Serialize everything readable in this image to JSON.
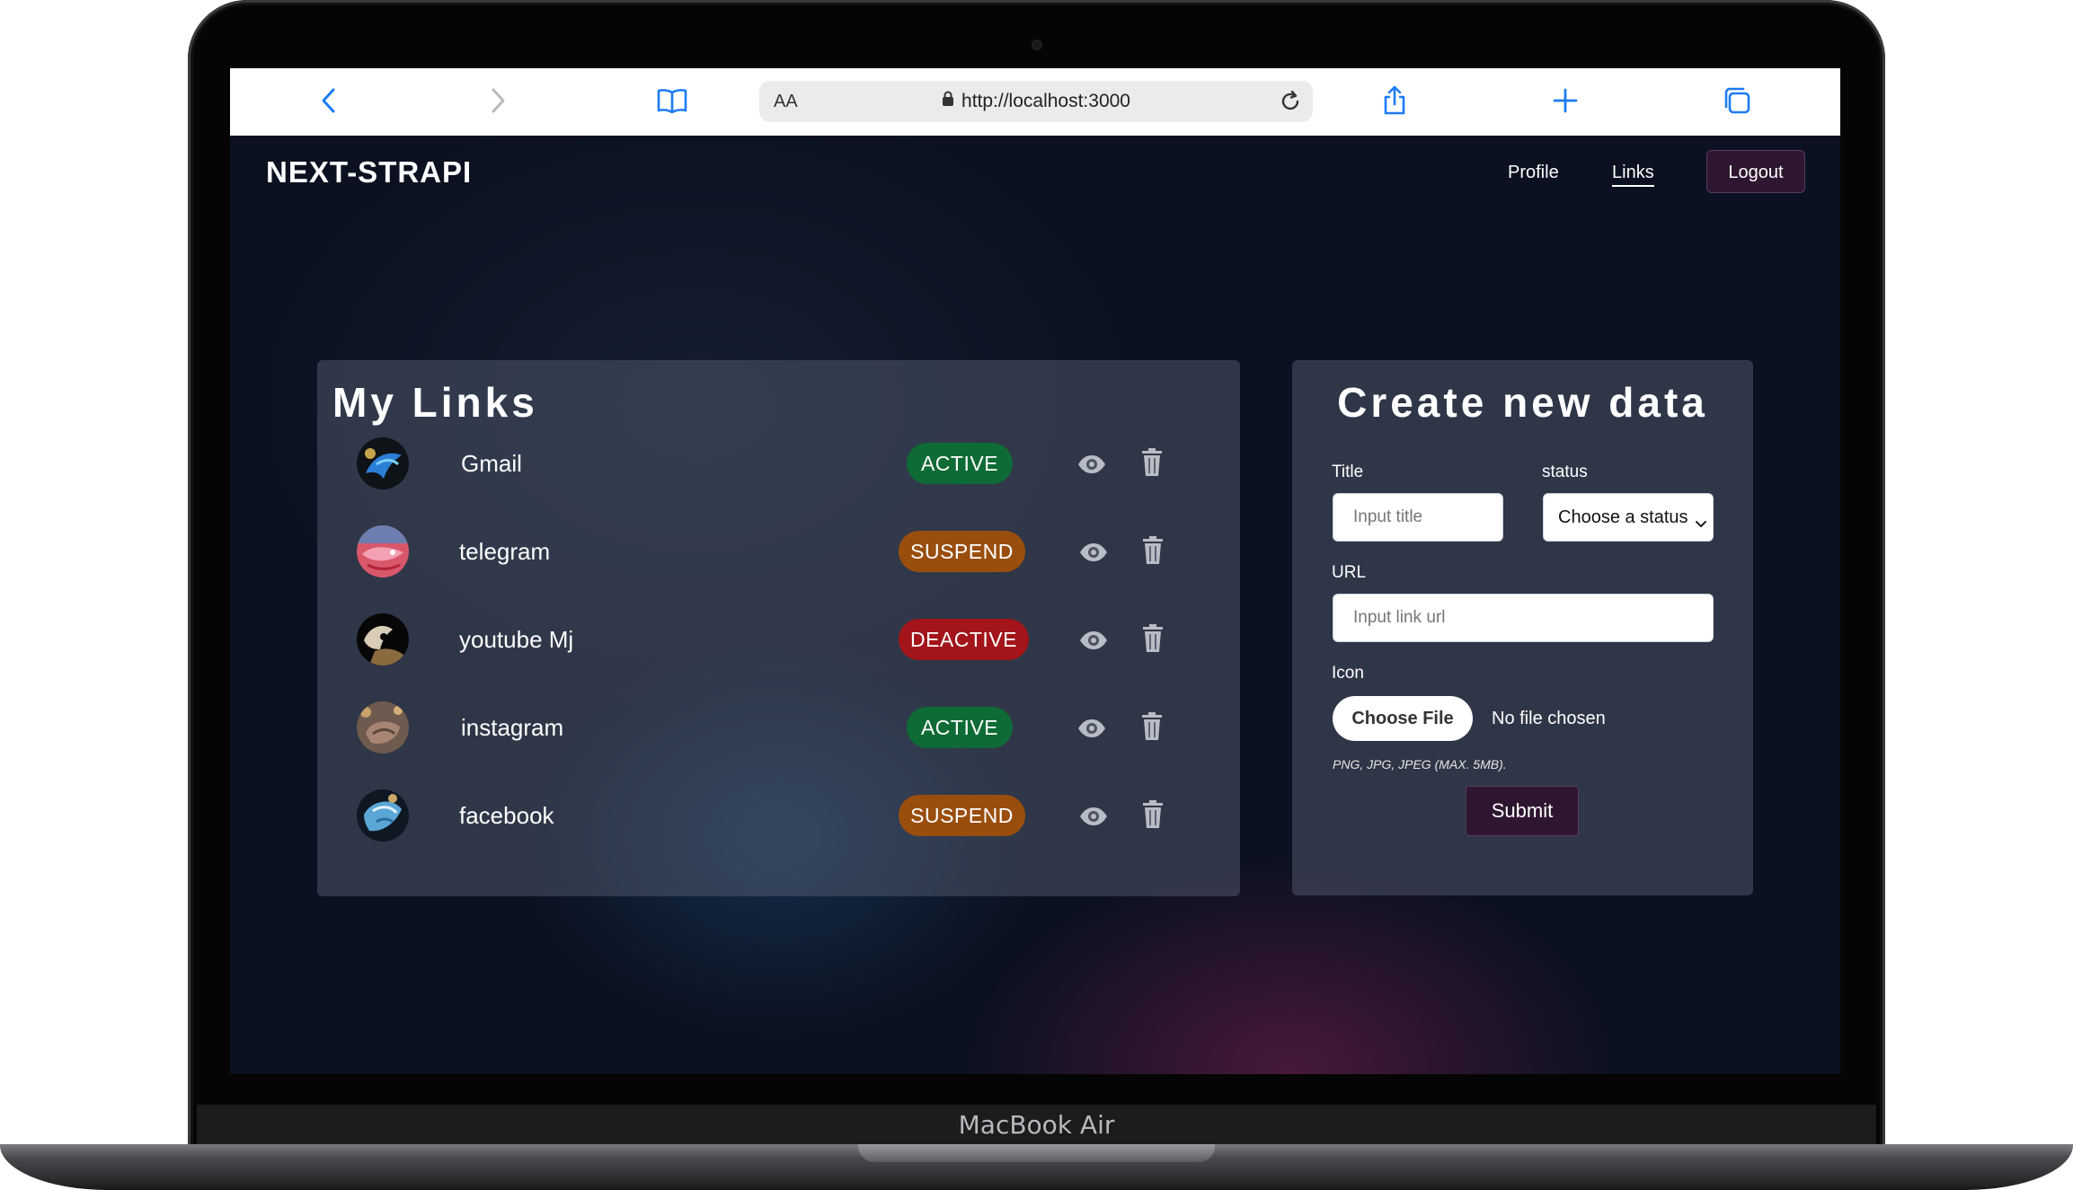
{
  "device": {
    "brand_label": "MacBook Air"
  },
  "browser": {
    "text_size_label": "AA",
    "url": "http://localhost:3000",
    "icons": [
      "back-icon",
      "forward-icon",
      "bookmarks-icon",
      "lock-icon",
      "reload-icon",
      "share-icon",
      "new-tab-icon",
      "tabs-icon"
    ]
  },
  "app": {
    "logo": "NEXT-STRAPI",
    "nav": {
      "profile": "Profile",
      "links": "Links",
      "logout": "Logout",
      "active": "Links"
    }
  },
  "links_panel": {
    "title": "My Links",
    "items": [
      {
        "name": "Gmail",
        "status": "ACTIVE",
        "status_color": "#0f6b35"
      },
      {
        "name": "telegram",
        "status": "SUSPEND",
        "status_color": "#9a4e0d"
      },
      {
        "name": "youtube Mj",
        "status": "DEACTIVE",
        "status_color": "#a3151a"
      },
      {
        "name": "instagram",
        "status": "ACTIVE",
        "status_color": "#0f6b35"
      },
      {
        "name": "facebook",
        "status": "SUSPEND",
        "status_color": "#9a4e0d"
      }
    ]
  },
  "create_form": {
    "title": "Create new data",
    "title_label": "Title",
    "title_placeholder": "Input title",
    "status_label": "status",
    "status_selected": "Choose a status",
    "url_label": "URL",
    "url_placeholder": "Input link url",
    "icon_label": "Icon",
    "file_button": "Choose File",
    "file_status": "No file chosen",
    "file_hint": "PNG, JPG, JPEG (MAX. 5MB).",
    "submit": "Submit"
  },
  "colors": {
    "accent_button": "#2e1630",
    "active": "#0f6b35",
    "suspend": "#9a4e0d",
    "deactive": "#a3151a",
    "ios_blue": "#1d7bf5"
  }
}
